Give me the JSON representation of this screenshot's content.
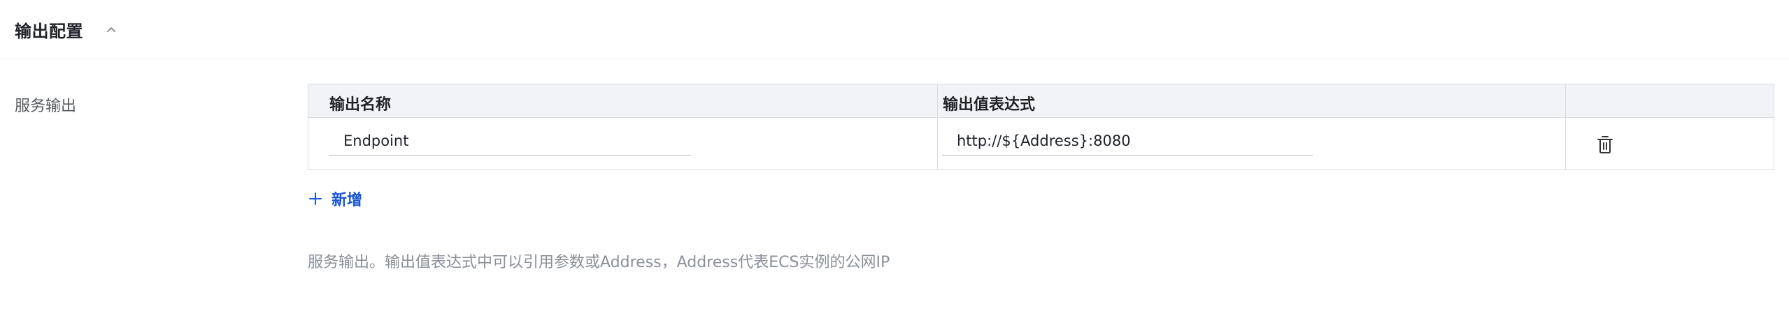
{
  "section": {
    "title": "输出配置"
  },
  "form": {
    "label": "服务输出",
    "table": {
      "headers": [
        "输出名称",
        "输出值表达式",
        ""
      ],
      "rows": [
        {
          "name": "Endpoint",
          "expression": "http://${Address}:8080"
        }
      ]
    },
    "add_label": "新增",
    "help_text": "服务输出。输出值表达式中可以引用参数或Address，Address代表ECS实例的公网IP"
  },
  "icons": {
    "collapse": "chevron-up-icon",
    "delete": "trash-icon",
    "add": "plus-icon"
  },
  "colors": {
    "accent": "#1a56d6",
    "header_bg": "#f1f3f6",
    "border": "#d9dde3",
    "muted_text": "#8a9099"
  }
}
